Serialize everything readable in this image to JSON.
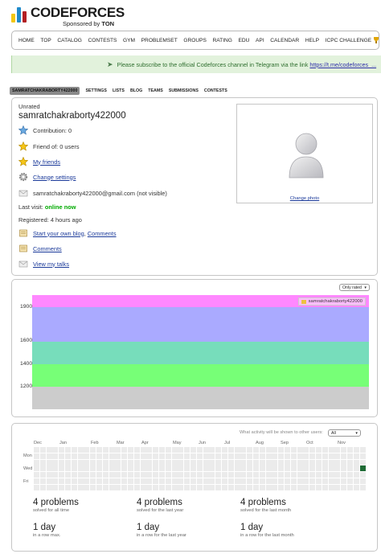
{
  "logo": {
    "text": "CODEFORCES",
    "sponsor_prefix": "Sponsored by",
    "sponsor_name": "TON"
  },
  "menu": [
    "HOME",
    "TOP",
    "CATALOG",
    "CONTESTS",
    "GYM",
    "PROBLEMSET",
    "GROUPS",
    "RATING",
    "EDU",
    "API",
    "CALENDAR",
    "HELP",
    "ICPC CHALLENGE"
  ],
  "banner": {
    "text": "Please subscribe to the official Codeforces channel in Telegram via the link",
    "link": "https://t.me/codeforces_..."
  },
  "profile_tabs": [
    "SAMRATCHAKRABORTY422000",
    "SETTINGS",
    "LISTS",
    "BLOG",
    "TEAMS",
    "SUBMISSIONS",
    "CONTESTS"
  ],
  "profile": {
    "rank": "Unrated",
    "handle": "samratchakraborty422000",
    "contribution_label": "Contribution:",
    "contribution_value": "0",
    "friend_of": "Friend of: 0 users",
    "my_friends": "My friends",
    "change_settings": "Change settings",
    "email": "samratchakraborty422000@gmail.com (not visible)",
    "last_visit_label": "Last visit:",
    "last_visit_value": "online now",
    "registered": "Registered: 4 hours ago",
    "blog_link": "Start your own blog",
    "blog_sep": ",",
    "comments_link1": "Comments",
    "comments_link2": "Comments",
    "talks_link": "View my talks",
    "change_photo": "Change photo"
  },
  "rating_graph": {
    "select": "Only rated",
    "legend": "samratchakraborty422000",
    "legend_color": "#edc240",
    "y_ticks": [
      "1900",
      "1600",
      "1400",
      "1200"
    ],
    "bands": [
      "#ff88ff",
      "#aaaaff",
      "#77ddbb",
      "#77ff77",
      "#cccccc"
    ]
  },
  "activity": {
    "label": "What activity will be shown to other users:",
    "select": "All",
    "months": [
      "Dec",
      "Jan",
      "Feb",
      "Mar",
      "Apr",
      "May",
      "Jun",
      "Jul",
      "Aug",
      "Sep",
      "Oct",
      "Nov"
    ],
    "days": [
      "Mon",
      "Wed",
      "Fri"
    ],
    "active_color": "#1e6b35",
    "stats": [
      {
        "big": "4 problems",
        "small": "solved for all time"
      },
      {
        "big": "4 problems",
        "small": "solved for the last year"
      },
      {
        "big": "4 problems",
        "small": "solved for the last month"
      },
      {
        "big": "1 day",
        "small": "in a row max."
      },
      {
        "big": "1 day",
        "small": "in a row for the last year"
      },
      {
        "big": "1 day",
        "small": "in a row for the last month"
      }
    ]
  }
}
